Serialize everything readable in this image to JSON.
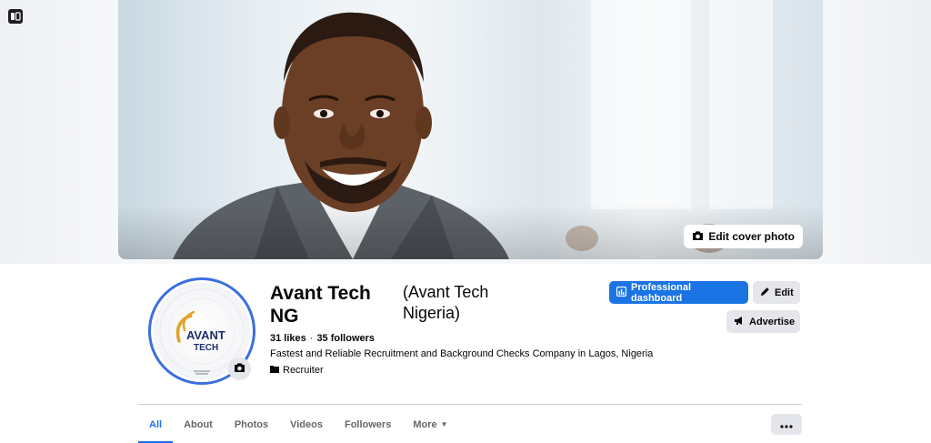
{
  "cover": {
    "edit_label": "Edit cover photo"
  },
  "profile": {
    "name": "Avant Tech NG",
    "alt_name": "(Avant Tech Nigeria)",
    "likes": "31 likes",
    "followers": "35 followers",
    "separator": "·",
    "bio": "Fastest and Reliable Recruitment and Background Checks Company in Lagos, Nigeria",
    "category": "Recruiter",
    "logo_line1": "AVANT",
    "logo_line2": "TECH"
  },
  "actions": {
    "dashboard": "Professional dashboard",
    "edit": "Edit",
    "advertise": "Advertise"
  },
  "tabs": [
    {
      "label": "All",
      "active": true
    },
    {
      "label": "About",
      "active": false
    },
    {
      "label": "Photos",
      "active": false
    },
    {
      "label": "Videos",
      "active": false
    },
    {
      "label": "Followers",
      "active": false
    },
    {
      "label": "More",
      "active": false
    }
  ],
  "colors": {
    "primary": "#1b74e4",
    "button_gray": "#e4e6eb",
    "avatar_ring": "#3b6fe0",
    "logo_accent": "#e0a428",
    "logo_navy": "#1f2f6b"
  }
}
